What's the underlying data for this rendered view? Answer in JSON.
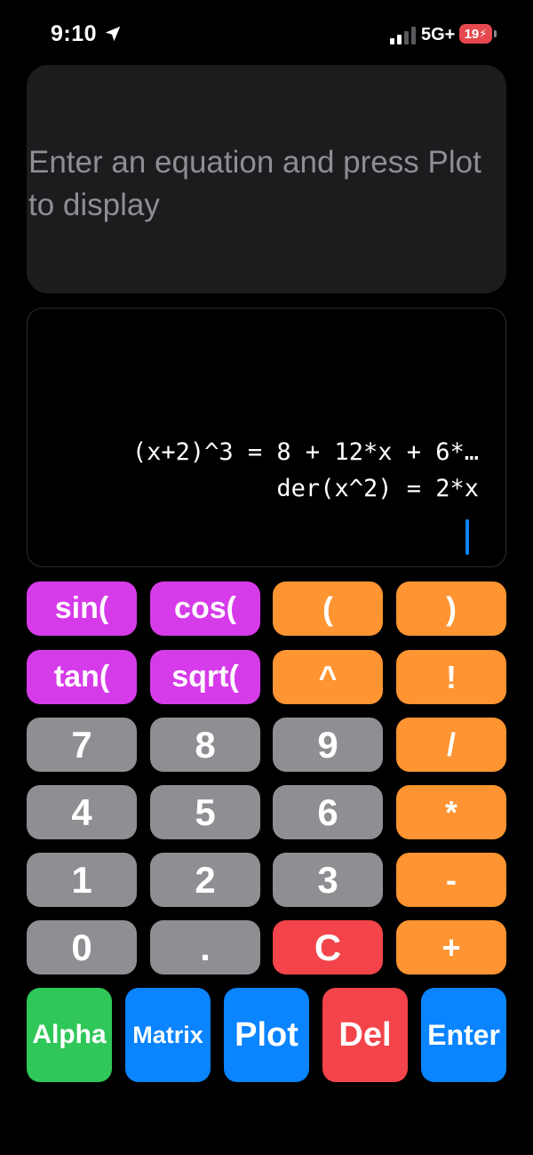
{
  "status_bar": {
    "time": "9:10",
    "network": "5G+",
    "battery": "19",
    "location_icon": "location-arrow-icon",
    "signal_icon": "signal-bars-icon",
    "battery_icon": "battery-charging-icon"
  },
  "plot": {
    "placeholder": "Enter an equation and press Plot to display"
  },
  "console": {
    "lines": [
      "(x+2)^3 = 8 + 12*x + 6*…",
      "der(x^2) = 2*x"
    ],
    "cursor_color": "#0a84ff"
  },
  "keys": {
    "row1": [
      "sin(",
      "cos(",
      "(",
      ")"
    ],
    "row2": [
      "tan(",
      "sqrt(",
      "^",
      "!"
    ],
    "row3": [
      "7",
      "8",
      "9",
      "/"
    ],
    "row4": [
      "4",
      "5",
      "6",
      "*"
    ],
    "row5": [
      "1",
      "2",
      "3",
      "-"
    ],
    "row6": [
      "0",
      ".",
      "C",
      "+"
    ]
  },
  "bottom_row": [
    "Alpha",
    "Matrix",
    "Plot",
    "Del",
    "Enter"
  ],
  "colors": {
    "function_key": "#d63be9",
    "operator_key": "#fe9432",
    "digit_key": "#8e8e93",
    "clear_key": "#f2444a",
    "alpha_key": "#30c759",
    "action_key": "#0a84ff"
  }
}
